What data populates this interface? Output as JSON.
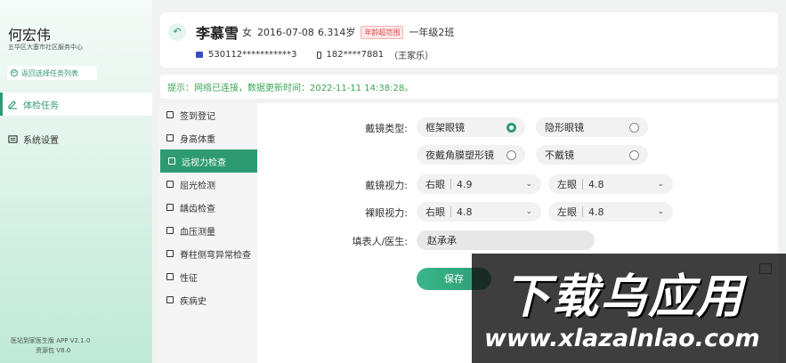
{
  "sidebar": {
    "user_name": "何宏伟",
    "org": "五华区大塞市社区服务中心",
    "back_label": "返回选择任务列表",
    "menu": [
      {
        "label": "体检任务",
        "icon": "edit-icon",
        "active": true
      },
      {
        "label": "系统设置",
        "icon": "settings-icon",
        "active": false
      }
    ],
    "version_app": "医站到家医生版 APP V2.1.0",
    "version_res": "资源包 V8.0"
  },
  "student": {
    "name": "李慕雪",
    "gender": "女",
    "birthdate": "2016-07-08",
    "age": "6.314岁",
    "age_badge": "年龄超范围",
    "class": "一年级2班",
    "id_number": "530112***********3",
    "phone": "182****7881",
    "guardian": "（王家乐）"
  },
  "notice": "提示：网络已连接，数据更新时间：2022-11-11  14:38:28。",
  "submenu": [
    {
      "label": "签到登记",
      "active": false
    },
    {
      "label": "身高体重",
      "active": false
    },
    {
      "label": "远视力检查",
      "active": true
    },
    {
      "label": "屈光检测",
      "active": false
    },
    {
      "label": "龋齿检查",
      "active": false
    },
    {
      "label": "血压测量",
      "active": false
    },
    {
      "label": "脊柱侧弯异常检查",
      "active": false
    },
    {
      "label": "性征",
      "active": false
    },
    {
      "label": "疾病史",
      "active": false
    }
  ],
  "form": {
    "glasses_type_label": "戴镜类型:",
    "glasses_options": [
      {
        "label": "框架眼镜",
        "selected": true
      },
      {
        "label": "隐形眼镜",
        "selected": false
      },
      {
        "label": "夜戴角膜塑形镜",
        "selected": false
      },
      {
        "label": "不戴镜",
        "selected": false
      }
    ],
    "corrected_label": "戴镜视力:",
    "corrected": {
      "right_label": "右眼",
      "right": "4.9",
      "left_label": "左眼",
      "left": "4.8"
    },
    "naked_label": "裸眼视力:",
    "naked": {
      "right_label": "右眼",
      "right": "4.8",
      "left_label": "左眼",
      "left": "4.8"
    },
    "filler_label": "填表人/医生:",
    "filler": "赵承承",
    "save": "保存"
  },
  "watermark": {
    "main": "下载乌应用",
    "url": "www.xlazalnlao.com"
  },
  "colors": {
    "accent": "#2e9a73",
    "notice": "#3aa553",
    "badge": "#e24c4c"
  }
}
